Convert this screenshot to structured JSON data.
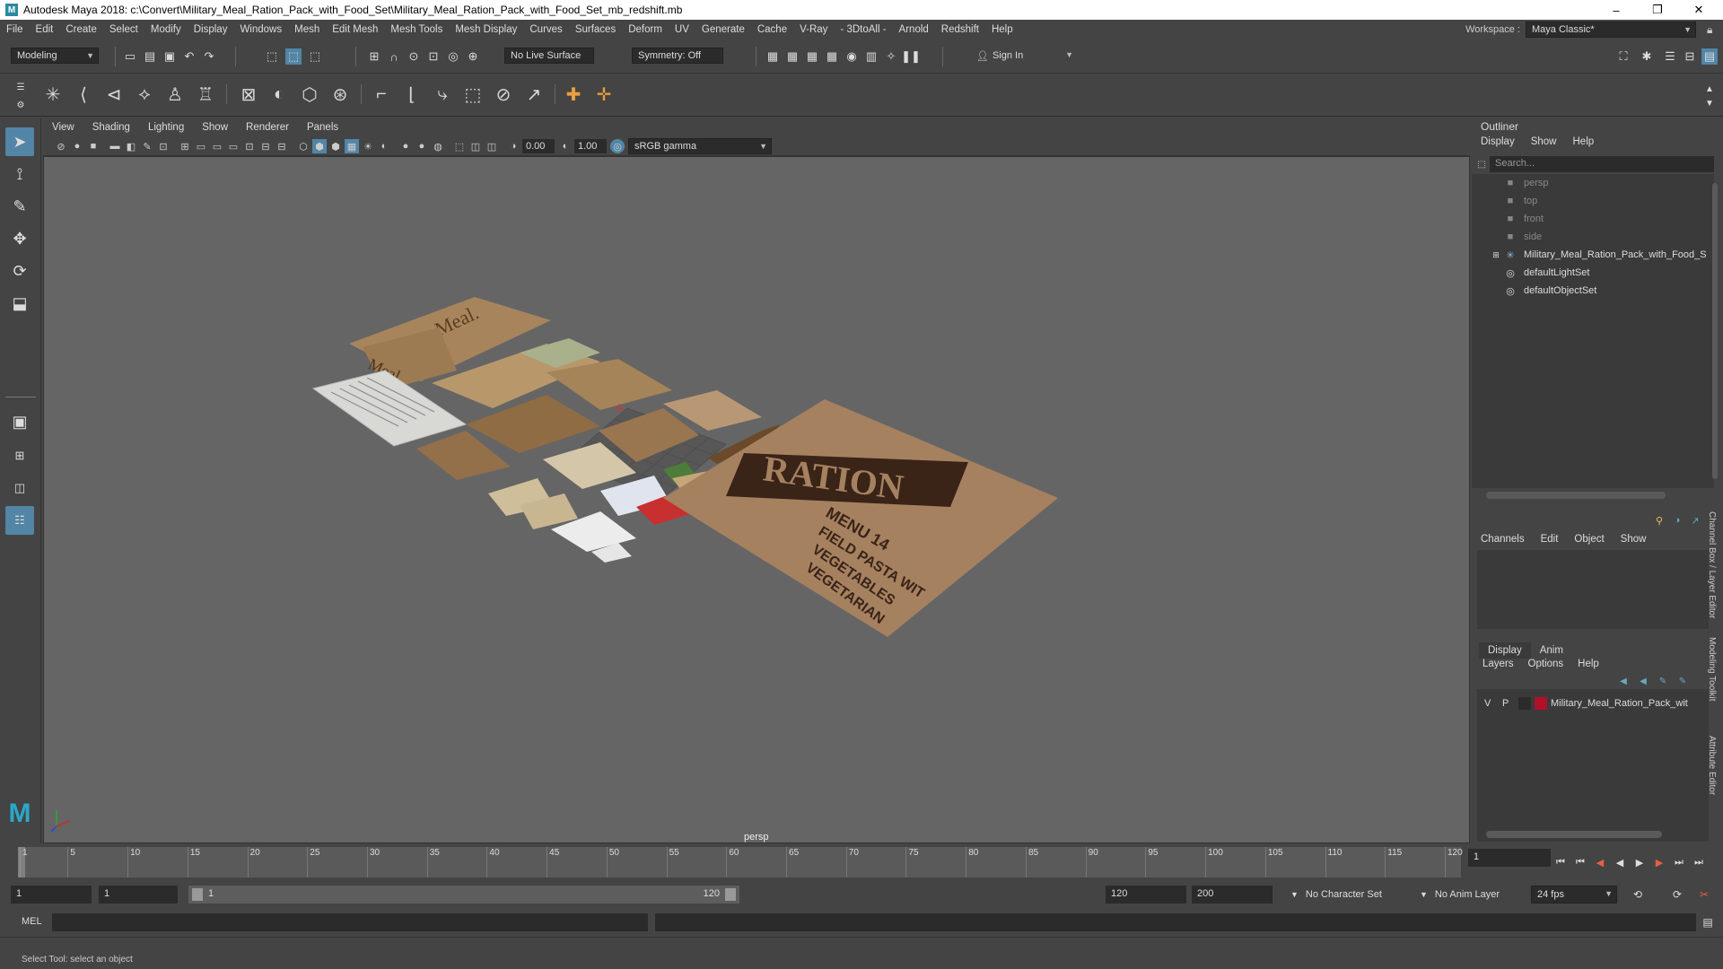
{
  "title": "Autodesk Maya 2018: c:\\Convert\\Military_Meal_Ration_Pack_with_Food_Set\\Military_Meal_Ration_Pack_with_Food_Set_mb_redshift.mb",
  "menus": [
    "File",
    "Edit",
    "Create",
    "Select",
    "Modify",
    "Display",
    "Windows",
    "Mesh",
    "Edit Mesh",
    "Mesh Tools",
    "Mesh Display",
    "Curves",
    "Surfaces",
    "Deform",
    "UV",
    "Generate",
    "Cache",
    "V-Ray",
    "- 3DtoAll -",
    "Arnold",
    "Redshift",
    "Help"
  ],
  "workspace": {
    "label": "Workspace :",
    "value": "Maya Classic*"
  },
  "status": {
    "mode": "Modeling",
    "live_surface": "No Live Surface",
    "symmetry": "Symmetry: Off",
    "sign_in": "Sign In"
  },
  "panel_menus": [
    "View",
    "Shading",
    "Lighting",
    "Show",
    "Renderer",
    "Panels"
  ],
  "panel_tools": {
    "exposure": "0.00",
    "gamma": "1.00",
    "colorspace": "sRGB gamma"
  },
  "viewport": {
    "camera": "persp",
    "bag_title": "RATION",
    "bag_lines": [
      "MENU 14",
      "FIELD PASTA WIT",
      "VEGETABLES",
      "VEGETARIAN"
    ],
    "meal_label": "Meal."
  },
  "outliner": {
    "title": "Outliner",
    "menu": [
      "Display",
      "Show",
      "Help"
    ],
    "search_placeholder": "Search...",
    "items": [
      {
        "label": "persp",
        "dim": true
      },
      {
        "label": "top",
        "dim": true
      },
      {
        "label": "front",
        "dim": true
      },
      {
        "label": "side",
        "dim": true
      },
      {
        "label": "Military_Meal_Ration_Pack_with_Food_S",
        "dim": false
      },
      {
        "label": "defaultLightSet",
        "dim": false
      },
      {
        "label": "defaultObjectSet",
        "dim": false
      }
    ]
  },
  "channel_box": {
    "menu": [
      "Channels",
      "Edit",
      "Object",
      "Show"
    ]
  },
  "layer_editor": {
    "tabs": [
      "Display",
      "Anim"
    ],
    "menu": [
      "Layers",
      "Options",
      "Help"
    ],
    "layer": {
      "v": "V",
      "p": "P",
      "name": "Military_Meal_Ration_Pack_wit",
      "color": "#b0102a"
    }
  },
  "side_tabs": [
    "Channel Box / Layer Editor",
    "Modeling Toolkit",
    "Attribute Editor"
  ],
  "timeline": {
    "ticks": [
      "1",
      "5",
      "10",
      "15",
      "20",
      "25",
      "30",
      "35",
      "40",
      "45",
      "50",
      "55",
      "60",
      "65",
      "70",
      "75",
      "80",
      "85",
      "90",
      "95",
      "100",
      "105",
      "110",
      "115",
      "120"
    ],
    "current": "1"
  },
  "range": {
    "start": "1",
    "start2": "1",
    "slider_start": "1",
    "slider_end": "120",
    "end": "120",
    "end2": "200",
    "char_set": "No Character Set",
    "anim_layer": "No Anim Layer",
    "fps": "24 fps"
  },
  "command": {
    "label": "MEL"
  },
  "help_line": "Select Tool: select an object"
}
